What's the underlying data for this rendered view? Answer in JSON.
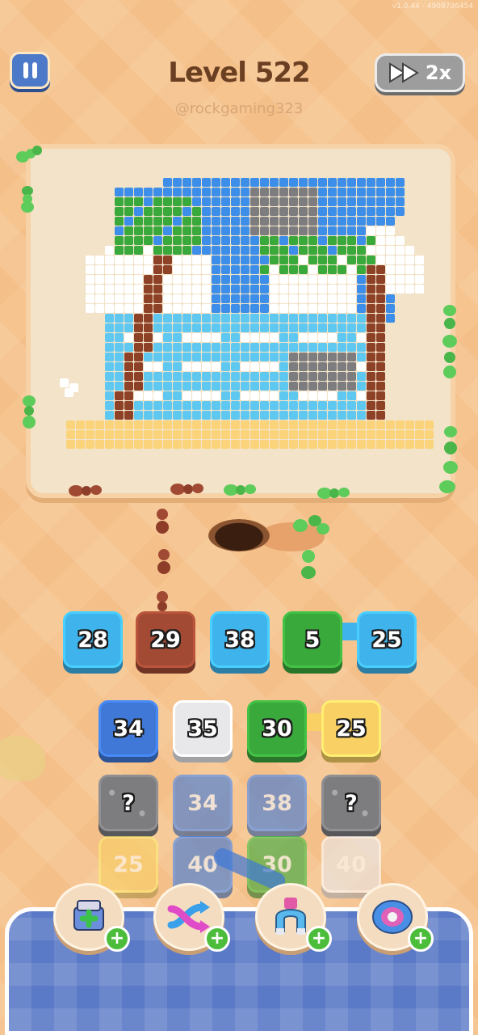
{
  "version_text": "v1.0.44 - 4908736454",
  "header": {
    "level_title": "Level 522",
    "handle": "@rockgaming323",
    "speed_label": "2x"
  },
  "colors": {
    "blue": "#3fb4ec",
    "dark_blue": "#3f78d6",
    "brown": "#a24a34",
    "green": "#3aa93c",
    "yellow": "#f8d064",
    "white": "#e8e8ea",
    "gray": "#7d7d80",
    "sky": "#3c8ee8",
    "cloud": "#ffffff",
    "sea": "#5ec8f0",
    "sand": "#fad37a",
    "trunk": "#8d4127"
  },
  "queue_tiles": [
    {
      "value": "28",
      "color": "blue"
    },
    {
      "value": "29",
      "color": "brown"
    },
    {
      "value": "38",
      "color": "blue"
    },
    {
      "value": "5",
      "color": "green"
    },
    {
      "value": "25",
      "color": "blue"
    }
  ],
  "grid": [
    [
      {
        "value": "34",
        "color": "dark_blue"
      },
      {
        "value": "35",
        "color": "white"
      },
      {
        "value": "30",
        "color": "green"
      },
      {
        "value": "25",
        "color": "yellow"
      }
    ],
    [
      {
        "value": "?",
        "color": "gray",
        "hidden": true
      },
      {
        "value": "34",
        "color": "dark_blue",
        "faded": true
      },
      {
        "value": "38",
        "color": "dark_blue",
        "faded": true
      },
      {
        "value": "?",
        "color": "gray",
        "hidden": true
      }
    ],
    [
      {
        "value": "25",
        "color": "yellow",
        "faded": true
      },
      {
        "value": "40",
        "color": "dark_blue",
        "faded": true
      },
      {
        "value": "30",
        "color": "green",
        "faded": true
      },
      {
        "value": "40",
        "color": "white",
        "faded": true
      }
    ]
  ],
  "boosters": [
    {
      "name": "add-slot",
      "icon": "box-plus-icon"
    },
    {
      "name": "shuffle",
      "icon": "shuffle-arrows-icon"
    },
    {
      "name": "magnet",
      "icon": "magnet-claw-icon"
    },
    {
      "name": "spool",
      "icon": "spool-icon"
    }
  ],
  "picture": {
    "description_colors": [
      "sky",
      "cloud",
      "sea",
      "sand",
      "trunk",
      "green",
      "gray"
    ]
  }
}
